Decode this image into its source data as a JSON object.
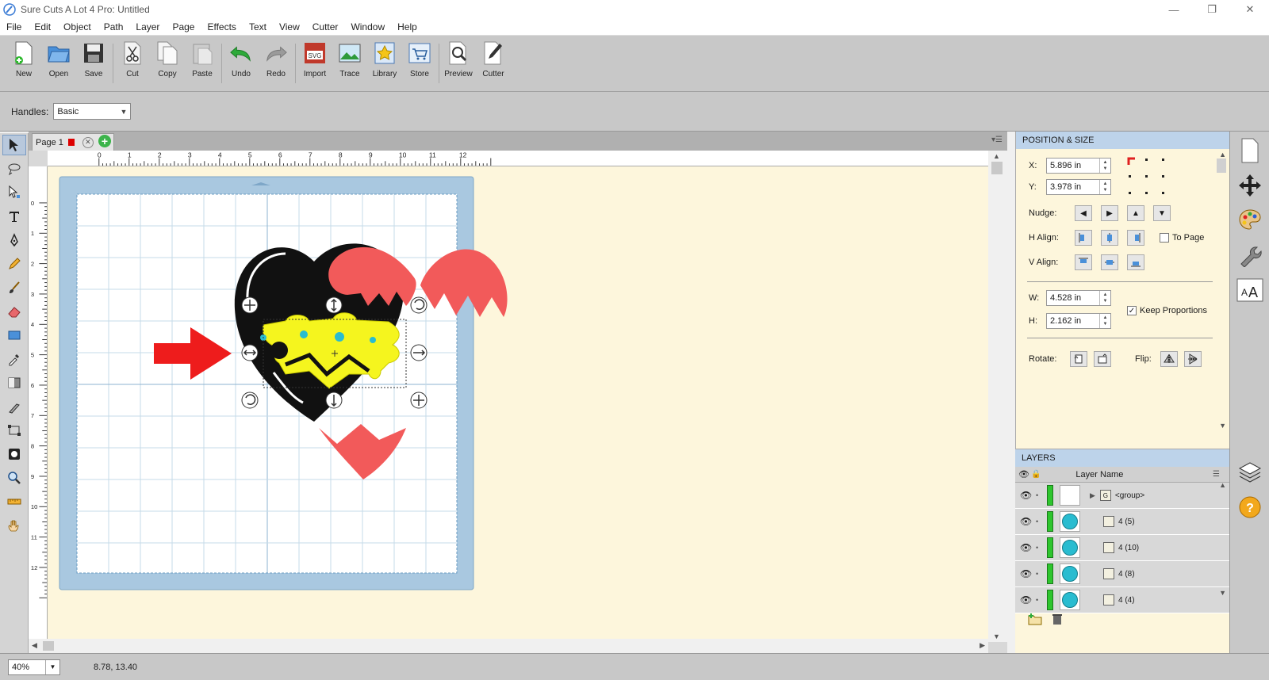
{
  "window": {
    "title": "Sure Cuts A Lot 4 Pro: Untitled",
    "controls": [
      "—",
      "❐",
      "✕"
    ]
  },
  "menu": [
    "File",
    "Edit",
    "Object",
    "Path",
    "Layer",
    "Page",
    "Effects",
    "Text",
    "View",
    "Cutter",
    "Window",
    "Help"
  ],
  "toolbar": {
    "new": "New",
    "open": "Open",
    "save": "Save",
    "cut": "Cut",
    "copy": "Copy",
    "paste": "Paste",
    "undo": "Undo",
    "redo": "Redo",
    "import": "Import",
    "trace": "Trace",
    "library": "Library",
    "store": "Store",
    "preview": "Preview",
    "cutter": "Cutter"
  },
  "options": {
    "handles_label": "Handles:",
    "handles_value": "Basic"
  },
  "document": {
    "tab_label": "Page 1",
    "ruler_top": [
      "0",
      "1",
      "2",
      "3",
      "4",
      "5",
      "6",
      "7",
      "8",
      "9",
      "10",
      "11",
      "12"
    ],
    "ruler_left": [
      "0",
      "1",
      "2",
      "3",
      "4",
      "5",
      "6",
      "7",
      "8",
      "9",
      "10",
      "11",
      "12"
    ]
  },
  "position_size": {
    "header": "POSITION & SIZE",
    "x_label": "X:",
    "x_value": "5.896 in",
    "y_label": "Y:",
    "y_value": "3.978 in",
    "nudge_label": "Nudge:",
    "halign_label": "H Align:",
    "valign_label": "V Align:",
    "to_page": "To Page",
    "w_label": "W:",
    "w_value": "4.528 in",
    "h_label": "H:",
    "h_value": "2.162 in",
    "keep_proportions": "Keep Proportions",
    "rotate_label": "Rotate:",
    "flip_label": "Flip:"
  },
  "layers": {
    "header": "LAYERS",
    "col_name": "Layer Name",
    "rows": [
      {
        "name": "<group>",
        "icon": "G"
      },
      {
        "name": "4 (5)",
        "icon": ""
      },
      {
        "name": "4 (10)",
        "icon": ""
      },
      {
        "name": "4 (8)",
        "icon": ""
      },
      {
        "name": "4 (4)",
        "icon": ""
      }
    ]
  },
  "status": {
    "zoom": "40%",
    "coords": "8.78, 13.40"
  },
  "colors": {
    "canvas_bg": "#fdf6dc",
    "mat_blue": "#a9c8e0",
    "heart_black": "#111111",
    "shape_coral": "#f25a5a",
    "puzzle_yellow": "#f5f51e",
    "arrow_red": "#ee1c1c",
    "panel_header": "#bdd3ea"
  }
}
